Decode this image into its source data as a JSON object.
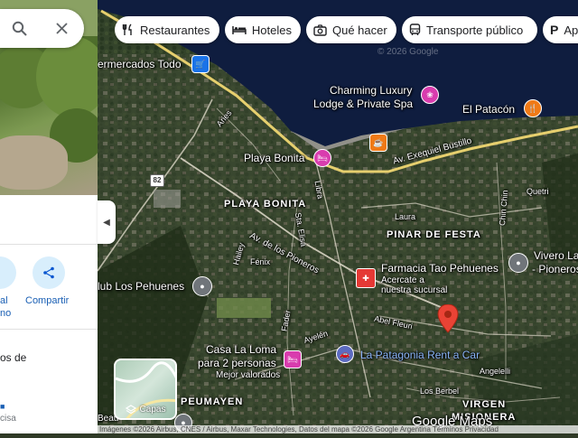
{
  "chips": [
    {
      "label": "Restaurantes",
      "icon": "fork-knife-icon"
    },
    {
      "label": "Hoteles",
      "icon": "bed-icon"
    },
    {
      "label": "Qué hacer",
      "icon": "camera-icon"
    },
    {
      "label": "Transporte público",
      "icon": "bus-icon"
    },
    {
      "label": "Ap",
      "icon": "parking-icon"
    }
  ],
  "panel": {
    "share_label": "Compartir",
    "action_partial_1": "al",
    "action_partial_2": "no",
    "text_partial_1": "os de",
    "text_partial_2": "cisa"
  },
  "map": {
    "watermark": "© 2026 Google",
    "pois": [
      "ermercados Todo",
      "Charming Luxury",
      "Lodge & Private Spa",
      "El Patacón",
      "Playa Bonita",
      "Farmacia Tao Pehuenes",
      "Acercate a",
      "nuestra sucursal",
      "Vivero La",
      "- Pioneros",
      "lub Los Pehuenes",
      "Casa La Loma",
      "para 2 personas",
      "Mejor valorados",
      "La Patagonia Rent a Car"
    ],
    "areas": [
      "PLAYA BONITA",
      "PINAR DE FESTA",
      "PEUMAYEN",
      "VIRGEN",
      "MISIONERA"
    ],
    "streets": [
      "Aries",
      "Av. Exequiel Bustillo",
      "Libra",
      "Sta. Elisa",
      "Av. de los Pioneros",
      "Hailey",
      "Fénix",
      "Laura",
      "Chin Chin",
      "Quetri",
      "Abel Fleuri",
      "Fader",
      "Ayelén",
      "Angelelli",
      "Los Berbel",
      "Beau"
    ],
    "route_number": "82",
    "google_logo": "Google Maps"
  },
  "layers_label": "Capas",
  "footer": "Imágenes ©2026 Airbus, CNES / Airbus, Maxar Technologies, Datos del mapa ©2026 Google    Argentina    Términos    Privacidad"
}
